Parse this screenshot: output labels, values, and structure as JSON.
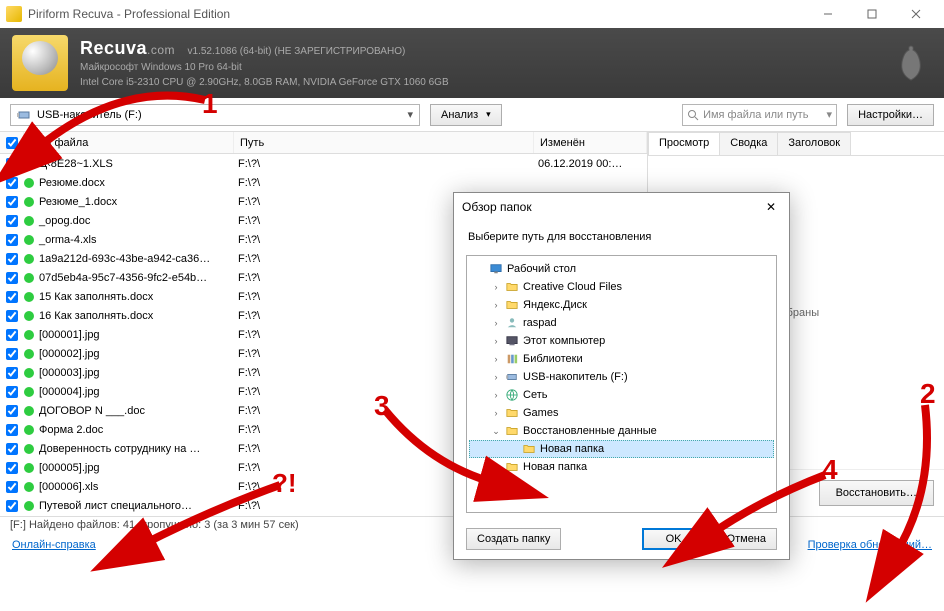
{
  "title": "Piriform Recuva - Professional Edition",
  "header": {
    "brand": "Recuva",
    "brand_suffix": ".com",
    "version": "v1.52.1086 (64-bit) (НЕ ЗАРЕГИСТРИРОВАНО)",
    "os_line": "Майкрософт Windows 10 Pro 64-bit",
    "hw_line": "Intel Core i5-2310 CPU @ 2.90GHz, 8.0GB RAM, NVIDIA GeForce GTX 1060 6GB"
  },
  "toolbar": {
    "drive": "USB-накопитель (F:)",
    "analyze": "Анализ",
    "search_placeholder": "Имя файла или путь",
    "settings": "Настройки…"
  },
  "table": {
    "headers": {
      "name": "Имя файла",
      "path": "Путь",
      "modified": "Изменён"
    },
    "rows": [
      {
        "name": "Ц‹8E28~1.XLS",
        "path": "F:\\?\\",
        "modified": "06.12.2019 00:…"
      },
      {
        "name": "Резюме.docx",
        "path": "F:\\?\\",
        "modified": ""
      },
      {
        "name": "Резюме_1.docx",
        "path": "F:\\?\\",
        "modified": ""
      },
      {
        "name": "_opog.doc",
        "path": "F:\\?\\",
        "modified": ""
      },
      {
        "name": "_orma-4.xls",
        "path": "F:\\?\\",
        "modified": ""
      },
      {
        "name": "1a9a212d-693c-43be-a942-ca36…",
        "path": "F:\\?\\",
        "modified": ""
      },
      {
        "name": "07d5eb4a-95c7-4356-9fc2-e54b…",
        "path": "F:\\?\\",
        "modified": ""
      },
      {
        "name": "15 Как заполнять.docx",
        "path": "F:\\?\\",
        "modified": ""
      },
      {
        "name": "16 Как заполнять.docx",
        "path": "F:\\?\\",
        "modified": ""
      },
      {
        "name": "[000001].jpg",
        "path": "F:\\?\\",
        "modified": ""
      },
      {
        "name": "[000002].jpg",
        "path": "F:\\?\\",
        "modified": ""
      },
      {
        "name": "[000003].jpg",
        "path": "F:\\?\\",
        "modified": ""
      },
      {
        "name": "[000004].jpg",
        "path": "F:\\?\\",
        "modified": ""
      },
      {
        "name": "ДОГОВОР N ___.doc",
        "path": "F:\\?\\",
        "modified": ""
      },
      {
        "name": "Форма 2.doc",
        "path": "F:\\?\\",
        "modified": ""
      },
      {
        "name": "Доверенность сотруднику на …",
        "path": "F:\\?\\",
        "modified": ""
      },
      {
        "name": "[000005].jpg",
        "path": "F:\\?\\",
        "modified": ""
      },
      {
        "name": "[000006].xls",
        "path": "F:\\?\\",
        "modified": ""
      },
      {
        "name": "Путевой лист специального…",
        "path": "F:\\?\\",
        "modified": ""
      }
    ]
  },
  "side": {
    "tabs": [
      "Просмотр",
      "Сводка",
      "Заголовок"
    ],
    "body": "выбраны",
    "restore": "Восстановить…"
  },
  "status": "[F:] Найдено файлов: 41, пропущено: 3 (за 3 мин 57 сек)",
  "footer": {
    "help": "Онлайн-справка",
    "updates": "Проверка обновлений…"
  },
  "dialog": {
    "title": "Обзор папок",
    "message": "Выберите путь для восстановления",
    "tree": [
      {
        "indent": 0,
        "expander": "",
        "icon": "desktop",
        "label": "Рабочий стол",
        "sel": false
      },
      {
        "indent": 1,
        "expander": "›",
        "icon": "folder",
        "label": "Creative Cloud Files",
        "sel": false
      },
      {
        "indent": 1,
        "expander": "›",
        "icon": "folder",
        "label": "Яндекс.Диск",
        "sel": false
      },
      {
        "indent": 1,
        "expander": "›",
        "icon": "user",
        "label": "raspad",
        "sel": false
      },
      {
        "indent": 1,
        "expander": "›",
        "icon": "pc",
        "label": "Этот компьютер",
        "sel": false
      },
      {
        "indent": 1,
        "expander": "›",
        "icon": "lib",
        "label": "Библиотеки",
        "sel": false
      },
      {
        "indent": 1,
        "expander": "›",
        "icon": "usb",
        "label": "USB-накопитель (F:)",
        "sel": false
      },
      {
        "indent": 1,
        "expander": "›",
        "icon": "net",
        "label": "Сеть",
        "sel": false
      },
      {
        "indent": 1,
        "expander": "›",
        "icon": "folder",
        "label": "Games",
        "sel": false
      },
      {
        "indent": 1,
        "expander": "⌄",
        "icon": "folder",
        "label": "Восстановленные данные",
        "sel": false
      },
      {
        "indent": 2,
        "expander": "",
        "icon": "folder",
        "label": "Новая папка",
        "sel": true
      },
      {
        "indent": 1,
        "expander": "›",
        "icon": "folder",
        "label": "Новая папка",
        "sel": false
      }
    ],
    "new_folder": "Создать папку",
    "ok": "OK",
    "cancel": "Отмена"
  },
  "annotations": {
    "n1": "1",
    "n2": "2",
    "n3": "3",
    "n4": "4",
    "q": "?!"
  }
}
